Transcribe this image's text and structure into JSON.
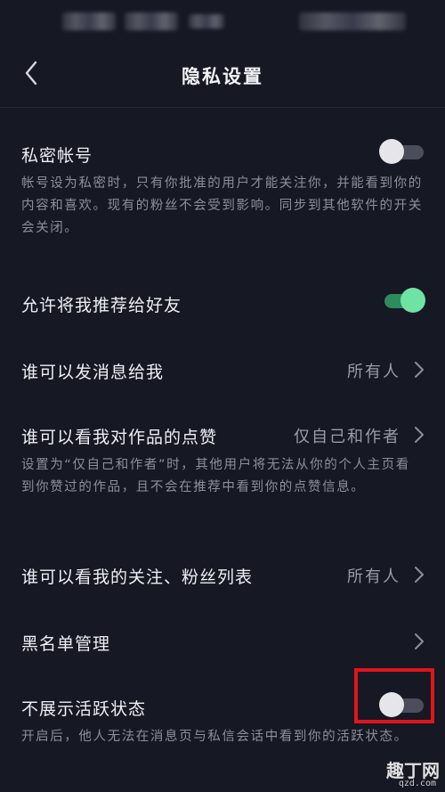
{
  "header": {
    "title": "隐私设置"
  },
  "settings": {
    "private_account": {
      "label": "私密帐号",
      "desc": "帐号设为私密时，只有你批准的用户才能关注你，并能看到你的内容和喜欢。现有的粉丝不会受到影响。同步到其他软件的开关会关闭。",
      "toggle": "off"
    },
    "recommend_friends": {
      "label": "允许将我推荐给好友",
      "toggle": "on"
    },
    "who_can_message": {
      "label": "谁可以发消息给我",
      "value": "所有人"
    },
    "who_can_see_likes": {
      "label": "谁可以看我对作品的点赞",
      "value": "仅自己和作者",
      "desc": "设置为“仅自己和作者”时，其他用户将无法从你的个人主页看到你赞过的作品，且不会在推荐中看到你的点赞信息。"
    },
    "who_can_see_following": {
      "label": "谁可以看我的关注、粉丝列表",
      "value": "所有人"
    },
    "blacklist": {
      "label": "黑名单管理"
    },
    "hide_active_status": {
      "label": "不展示活跃状态",
      "desc": "开启后，他人无法在消息页与私信会话中看到你的活跃状态。",
      "toggle": "off"
    }
  },
  "watermark": {
    "logo": "趣丁网",
    "url": "qzd.com"
  },
  "colors": {
    "background": "#161824",
    "toggle_on": "#6fe3a3",
    "toggle_off": "#4b4d5a",
    "highlight_box": "#e0151c"
  }
}
